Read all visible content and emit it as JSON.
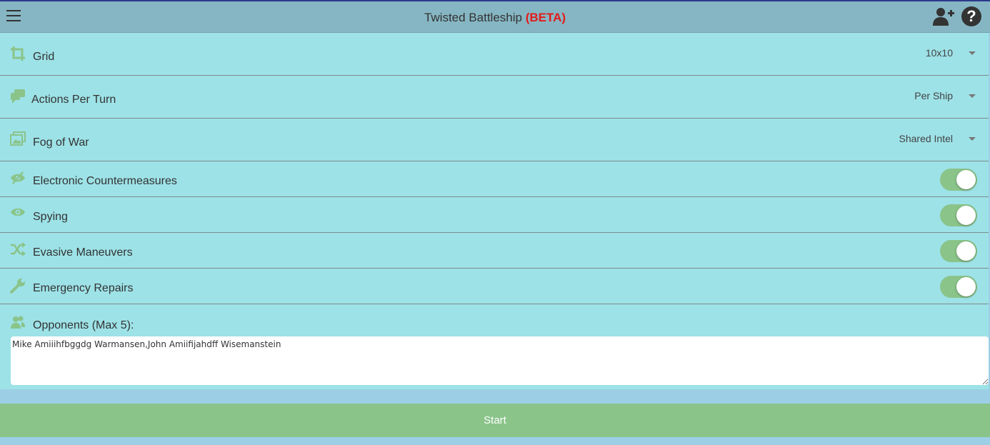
{
  "header": {
    "title": "Twisted Battleship",
    "beta": "(BETA)",
    "menu_icon": "hamburger-icon",
    "add_user_icon": "add-user-icon",
    "help_icon": "help-icon",
    "help_glyph": "?"
  },
  "settings": {
    "selects": [
      {
        "label": "Grid",
        "value": "10x10",
        "icon": "crop-icon"
      },
      {
        "label": "Actions Per Turn",
        "value": "Per Ship",
        "icon": "chat-bubbles-icon"
      },
      {
        "label": "Fog of War",
        "value": "Shared Intel",
        "icon": "image-icon"
      }
    ],
    "toggles": [
      {
        "label": "Electronic Countermeasures",
        "on": true,
        "icon": "eye-slash-icon"
      },
      {
        "label": "Spying",
        "on": true,
        "icon": "eye-icon"
      },
      {
        "label": "Evasive Maneuvers",
        "on": true,
        "icon": "shuffle-icon"
      },
      {
        "label": "Emergency Repairs",
        "on": true,
        "icon": "wrench-icon"
      }
    ]
  },
  "opponents": {
    "label": "Opponents (Max 5):",
    "value": "Mike Amiiihfbggdg Warmansen,John Amiifijahdff Wisemanstein",
    "icon": "users-icon"
  },
  "start_label": "Start",
  "colors": {
    "header_bg": "#86b6c3",
    "panel_bg": "#9de2e7",
    "accent_green": "#8ac489",
    "beta_red": "#e31b1b"
  }
}
